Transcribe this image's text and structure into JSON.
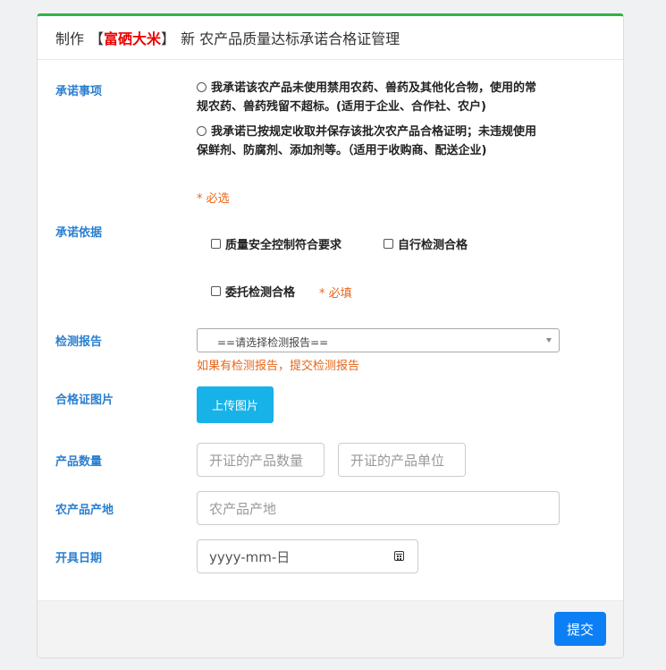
{
  "header": {
    "prefix": "制作",
    "bracket_open": "【",
    "product_name": "富硒大米",
    "bracket_close": "】",
    "title": "新 农产品质量达标承诺合格证管理"
  },
  "commitment": {
    "label": "承诺事项",
    "options": [
      "我承诺该农产品未使用禁用农药、兽药及其他化合物，使用的常规农药、兽药残留不超标。(适用于企业、合作社、农户)",
      "我承诺已按规定收取并保存该批次农产品合格证明；未违规使用保鲜剂、防腐剂、添加剂等。（适用于收购商、配送企业)"
    ],
    "required_note": "* 必选"
  },
  "basis": {
    "label": "承诺依据",
    "options": [
      "质量安全控制符合要求",
      "自行检测合格",
      "委托检测合格"
    ],
    "required_note": "* 必填"
  },
  "report": {
    "label": "检测报告",
    "selected": "==请选择检测报告==",
    "hint": "如果有检测报告，提交检测报告"
  },
  "certificate_image": {
    "label": "合格证图片",
    "upload_label": "上传图片"
  },
  "quantity": {
    "label": "产品数量",
    "amount_placeholder": "开证的产品数量",
    "unit_placeholder": "开证的产品单位"
  },
  "origin": {
    "label": "农产品产地",
    "placeholder": "农产品产地"
  },
  "issue_date": {
    "label": "开具日期",
    "placeholder": "yyyy-mm-日"
  },
  "footer": {
    "submit_label": "提交"
  }
}
